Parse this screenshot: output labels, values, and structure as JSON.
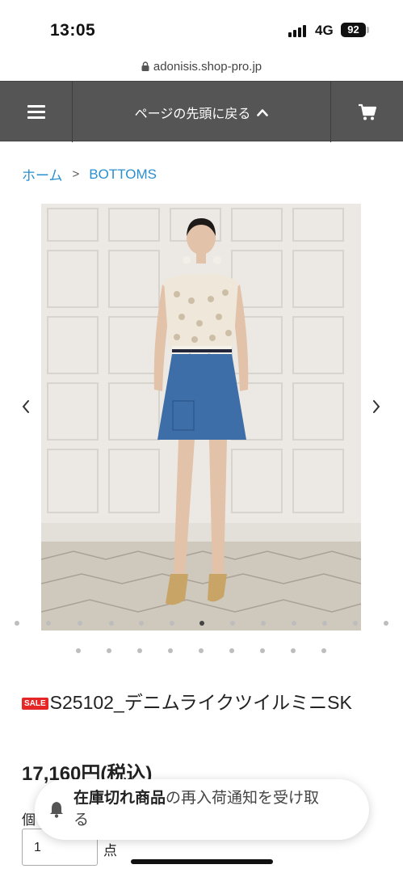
{
  "status": {
    "time": "13:05",
    "network": "4G",
    "battery": "92"
  },
  "browser": {
    "url": "adonisis.shop-pro.jp"
  },
  "nav": {
    "back_to_top": "ページの先頭に戻る"
  },
  "breadcrumb": {
    "home": "ホーム",
    "separator": ">",
    "current": "BOTTOMS"
  },
  "product": {
    "sale_badge": "SALE",
    "title": "S25102_デニムライクツイルミニSK",
    "price": "17,160円(税込)",
    "quantity_label": "個",
    "quantity_value": "1",
    "quantity_unit": "点"
  },
  "restock": {
    "text_bold": "在庫切れ商品",
    "text_rest": "の再入荷通知を受け取る"
  },
  "icons": {
    "menu": "hamburger-icon",
    "top": "chevron-up-icon",
    "cart": "cart-icon",
    "prev": "chevron-left-icon",
    "next": "chevron-right-icon",
    "bell": "bell-icon",
    "lock": "lock-icon"
  },
  "colors": {
    "nav_bg": "#555555",
    "link": "#2a8fd0",
    "sale": "#e52626"
  }
}
